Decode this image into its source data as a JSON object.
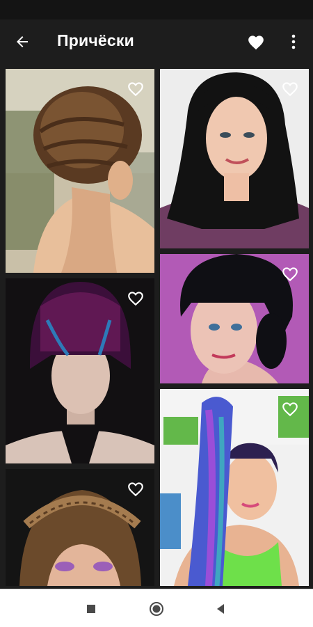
{
  "app_bar": {
    "title": "Причёски",
    "back_icon": "arrow-left-icon",
    "favorites_icon": "heart-filled-icon",
    "menu_icon": "more-vertical-icon"
  },
  "gallery": {
    "items": [
      {
        "name": "hairstyle-braided-updo",
        "favorite": false
      },
      {
        "name": "hairstyle-dark-waves",
        "favorite": false
      },
      {
        "name": "hairstyle-purple-bob",
        "favorite": false
      },
      {
        "name": "hairstyle-beehive-bangs",
        "favorite": false
      },
      {
        "name": "hairstyle-rainbow-ponytail",
        "favorite": false
      },
      {
        "name": "hairstyle-braided-crown",
        "favorite": false
      }
    ]
  },
  "nav": {
    "recents_icon": "square-icon",
    "home_icon": "circle-icon",
    "back_icon": "triangle-back-icon"
  },
  "colors": {
    "background": "#1d1d1d",
    "status_bar": "#141414",
    "nav_bar": "#ffffff",
    "title": "#ffffff"
  }
}
